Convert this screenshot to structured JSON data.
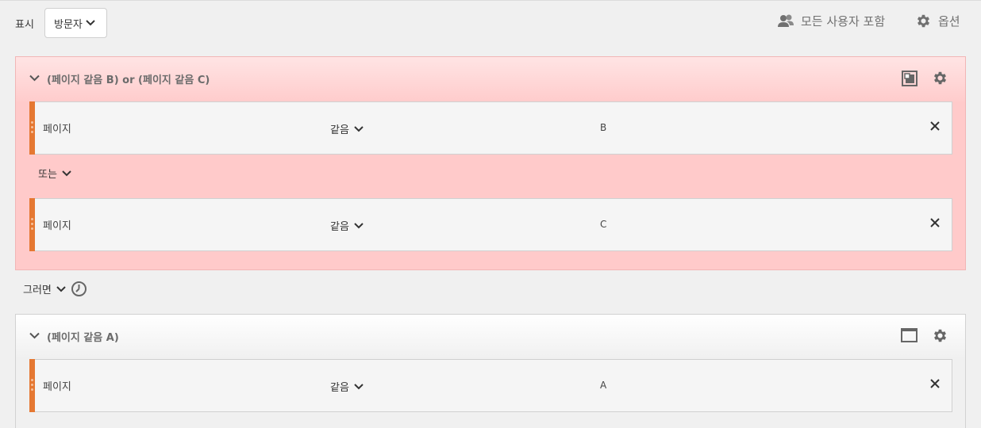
{
  "header": {
    "show_label": "표시",
    "show_select": "방문자",
    "include_all": "모든 사용자 포함",
    "options": "옵션"
  },
  "container1": {
    "title": "(페이지 같음 B) or (페이지 같음 C)",
    "rules": [
      {
        "dimension": "페이지",
        "operator": "같음",
        "value": "B"
      },
      {
        "dimension": "페이지",
        "operator": "같음",
        "value": "C"
      }
    ],
    "logic_operator": "또는"
  },
  "sequence": {
    "then_label": "그러면"
  },
  "container2": {
    "title": "(페이지 같음 A)",
    "rules": [
      {
        "dimension": "페이지",
        "operator": "같음",
        "value": "A"
      }
    ]
  },
  "colors": {
    "accent": "#e57832",
    "pink_bg": "#ffcaca",
    "icon_gray": "#707070"
  }
}
